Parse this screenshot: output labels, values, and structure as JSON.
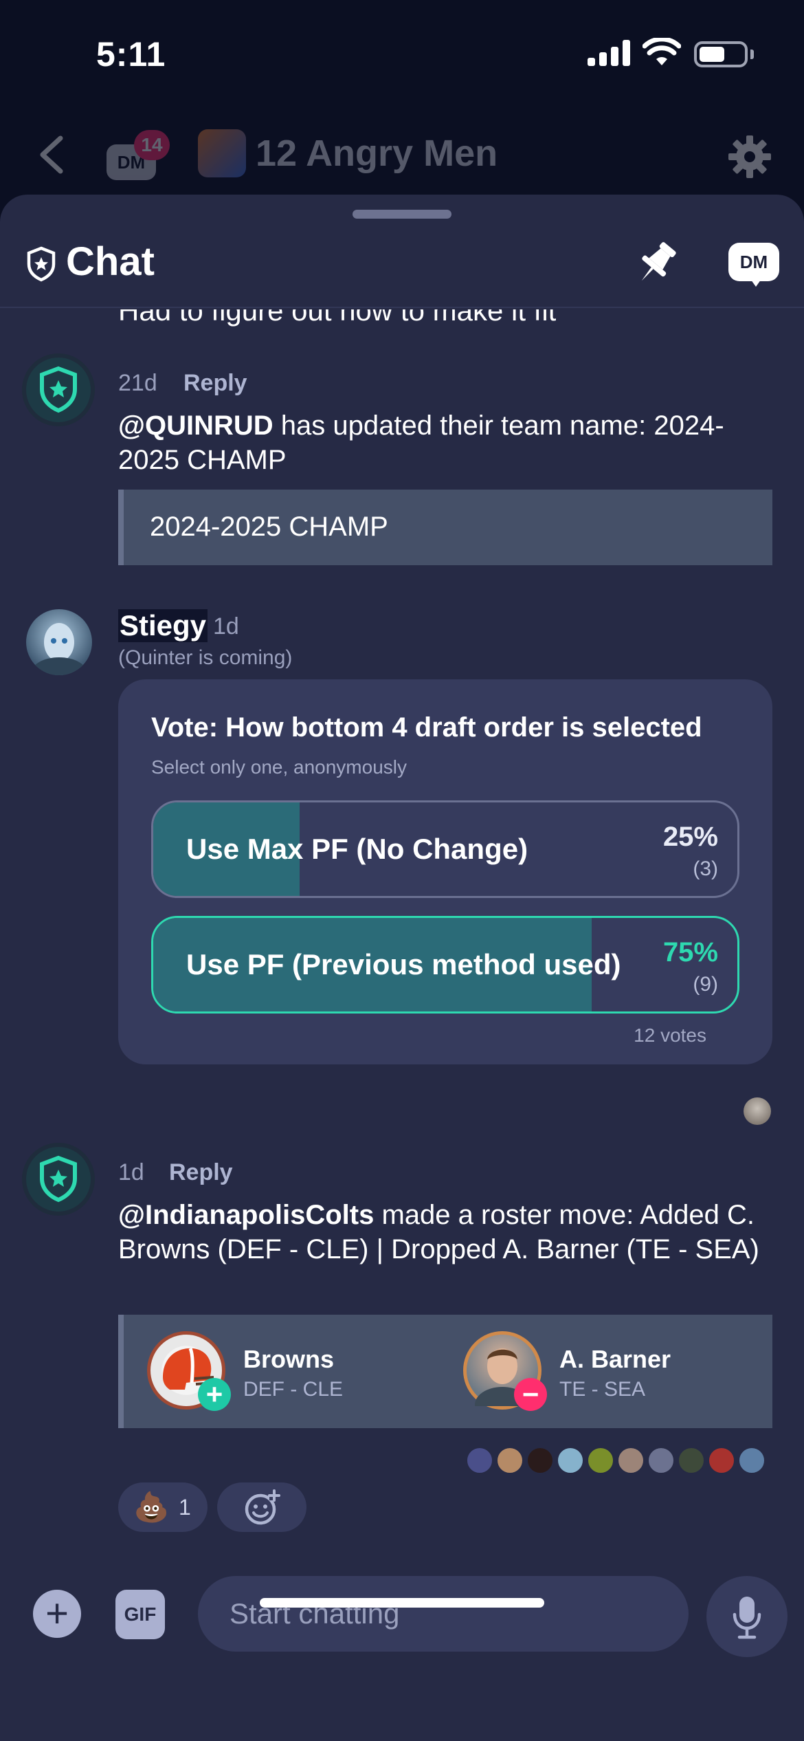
{
  "status": {
    "time": "5:11"
  },
  "header": {
    "dm_label": "DM",
    "dm_badge": "14",
    "league_name": "12 Angry Men"
  },
  "chat": {
    "title": "Chat",
    "dm_label": "DM"
  },
  "messages": {
    "top_cut": "Had to figure out how to make it fit",
    "team_name": {
      "time": "21d",
      "reply": "Reply",
      "mention": "@QUINRUD",
      "text": " has updated their team name: 2024-2025 CHAMP",
      "quote": "2024-2025 CHAMP"
    },
    "poll": {
      "user": "Stiegy",
      "time": "1d",
      "subtitle": "(Quinter is coming)",
      "title": "Vote: How bottom 4 draft order is selected",
      "instructions": "Select only one, anonymously",
      "options": [
        {
          "label": "Use Max PF (No Change)",
          "pct": "25%",
          "count": "(3)",
          "share": 0.25
        },
        {
          "label": "Use PF (Previous method used)",
          "pct": "75%",
          "count": "(9)",
          "share": 0.75
        }
      ],
      "votes": "12 votes"
    },
    "roster": {
      "time": "1d",
      "reply": "Reply",
      "mention": "@IndianapolisColts",
      "text": " made a roster move: Added C. Browns (DEF - CLE) | Dropped A. Barner (TE - SEA)",
      "added": {
        "name": "Browns",
        "pos": "DEF - CLE"
      },
      "dropped": {
        "name": "A. Barner",
        "pos": "TE - SEA"
      }
    },
    "reactions": [
      {
        "emoji": "💩",
        "count": "1"
      }
    ]
  },
  "composer": {
    "gif": "GIF",
    "placeholder": "Start chatting"
  },
  "colors": {
    "accent": "#2ed9b0",
    "badge": "#ff2e6e",
    "sheet": "#262a45",
    "poll_fill": "#2b6b78"
  }
}
